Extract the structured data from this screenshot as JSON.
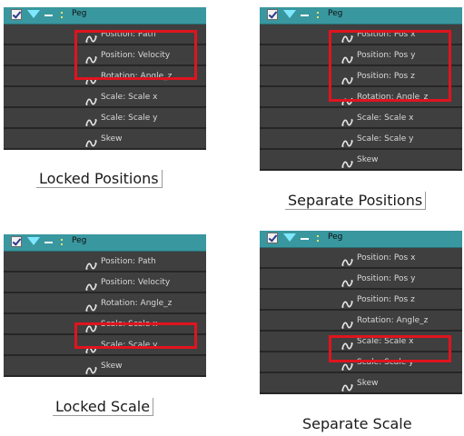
{
  "panels": [
    {
      "name": "Peg",
      "rows": [
        "Position: Path",
        "Position: Velocity",
        "Rotation: Angle_z",
        "Scale: Scale x",
        "Scale: Scale y",
        "Skew"
      ],
      "caption": "Locked Positions"
    },
    {
      "name": "Peg",
      "rows": [
        "Position: Pos x",
        "Position: Pos y",
        "Position: Pos z",
        "Rotation: Angle_z",
        "Scale: Scale x",
        "Scale: Scale y",
        "Skew"
      ],
      "caption": "Separate Positions"
    },
    {
      "name": "Peg",
      "rows": [
        "Position: Path",
        "Position: Velocity",
        "Rotation: Angle_z",
        "Scale: Scale x",
        "Scale: Scale y",
        "Skew"
      ],
      "caption": "Locked Scale"
    },
    {
      "name": "Peg",
      "rows": [
        "Position: Pos x",
        "Position: Pos y",
        "Position: Pos z",
        "Rotation: Angle_z",
        "Scale: Scale x",
        "Scale: Scale y",
        "Skew"
      ],
      "caption": "Separate Scale"
    }
  ],
  "colors": {
    "header": "#39979f",
    "row": "#3f3f3f",
    "highlight": "#e0141e"
  },
  "icons": {
    "enable": "checkbox-icon",
    "expand": "triangle-down-icon",
    "curve": "function-curve-icon"
  }
}
